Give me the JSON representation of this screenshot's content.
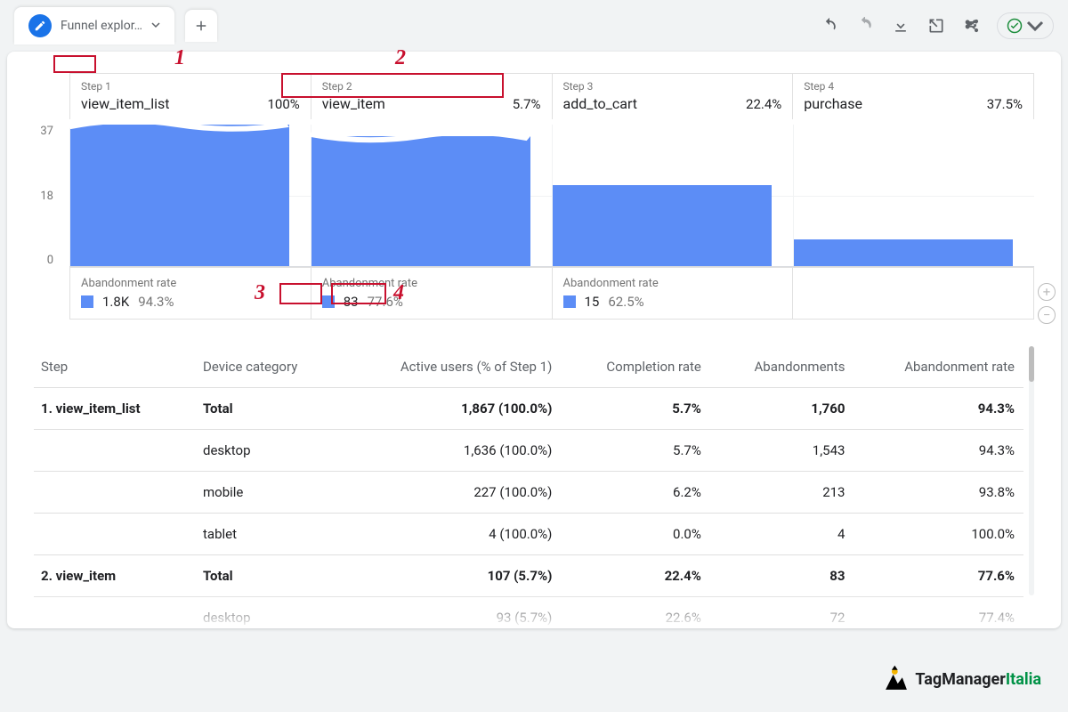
{
  "tab": {
    "title": "Funnel explor…"
  },
  "toolbar_icons": {
    "undo": "undo-icon",
    "redo": "redo-icon",
    "download": "download-icon",
    "export": "export-icon",
    "share": "share-icon",
    "status": "check-icon"
  },
  "chart_data": {
    "type": "bar",
    "title": "Funnel exploration",
    "ylabel": "",
    "xlabel": "",
    "ylim": [
      0,
      37
    ],
    "yticks": [
      37,
      18,
      0
    ],
    "categories": [
      "view_item_list",
      "view_item",
      "add_to_cart",
      "purchase"
    ],
    "series": [
      {
        "name": "bar_height_approx",
        "values": [
          37,
          34,
          21,
          7
        ]
      }
    ],
    "steps": [
      {
        "label": "Step 1",
        "name": "view_item_list",
        "pct": "100%",
        "abandon_label": "Abandonment rate",
        "abandon_count": "1.8K",
        "abandon_pct": "94.3%"
      },
      {
        "label": "Step 2",
        "name": "view_item",
        "pct": "5.7%",
        "abandon_label": "Abandonment rate",
        "abandon_count": "83",
        "abandon_pct": "77.6%"
      },
      {
        "label": "Step 3",
        "name": "add_to_cart",
        "pct": "22.4%",
        "abandon_label": "Abandonment rate",
        "abandon_count": "15",
        "abandon_pct": "62.5%"
      },
      {
        "label": "Step 4",
        "name": "purchase",
        "pct": "37.5%",
        "abandon_label": "",
        "abandon_count": "",
        "abandon_pct": ""
      }
    ]
  },
  "table": {
    "headers": {
      "step": "Step",
      "device": "Device category",
      "active": "Active users (% of Step 1)",
      "completion": "Completion rate",
      "aband": "Abandonments",
      "abandrate": "Abandonment rate"
    },
    "rows": [
      {
        "step": "1. view_item_list",
        "device": "Total",
        "active": "1,867 (100.0%)",
        "completion": "5.7%",
        "aband": "1,760",
        "abandrate": "94.3%",
        "total": true
      },
      {
        "step": "",
        "device": "desktop",
        "active": "1,636 (100.0%)",
        "completion": "5.7%",
        "aband": "1,543",
        "abandrate": "94.3%"
      },
      {
        "step": "",
        "device": "mobile",
        "active": "227 (100.0%)",
        "completion": "6.2%",
        "aband": "213",
        "abandrate": "93.8%"
      },
      {
        "step": "",
        "device": "tablet",
        "active": "4 (100.0%)",
        "completion": "0.0%",
        "aband": "4",
        "abandrate": "100.0%"
      },
      {
        "step": "2. view_item",
        "device": "Total",
        "active": "107 (5.7%)",
        "completion": "22.4%",
        "aband": "83",
        "abandrate": "77.6%",
        "total": true
      },
      {
        "step": "",
        "device": "desktop",
        "active": "93 (5.7%)",
        "completion": "22.6%",
        "aband": "72",
        "abandrate": "77.4%"
      }
    ]
  },
  "annotations": {
    "n1": "1",
    "n2": "2",
    "n3": "3",
    "n4": "4"
  },
  "logo": {
    "a": "TagManager",
    "b": "Italia"
  }
}
